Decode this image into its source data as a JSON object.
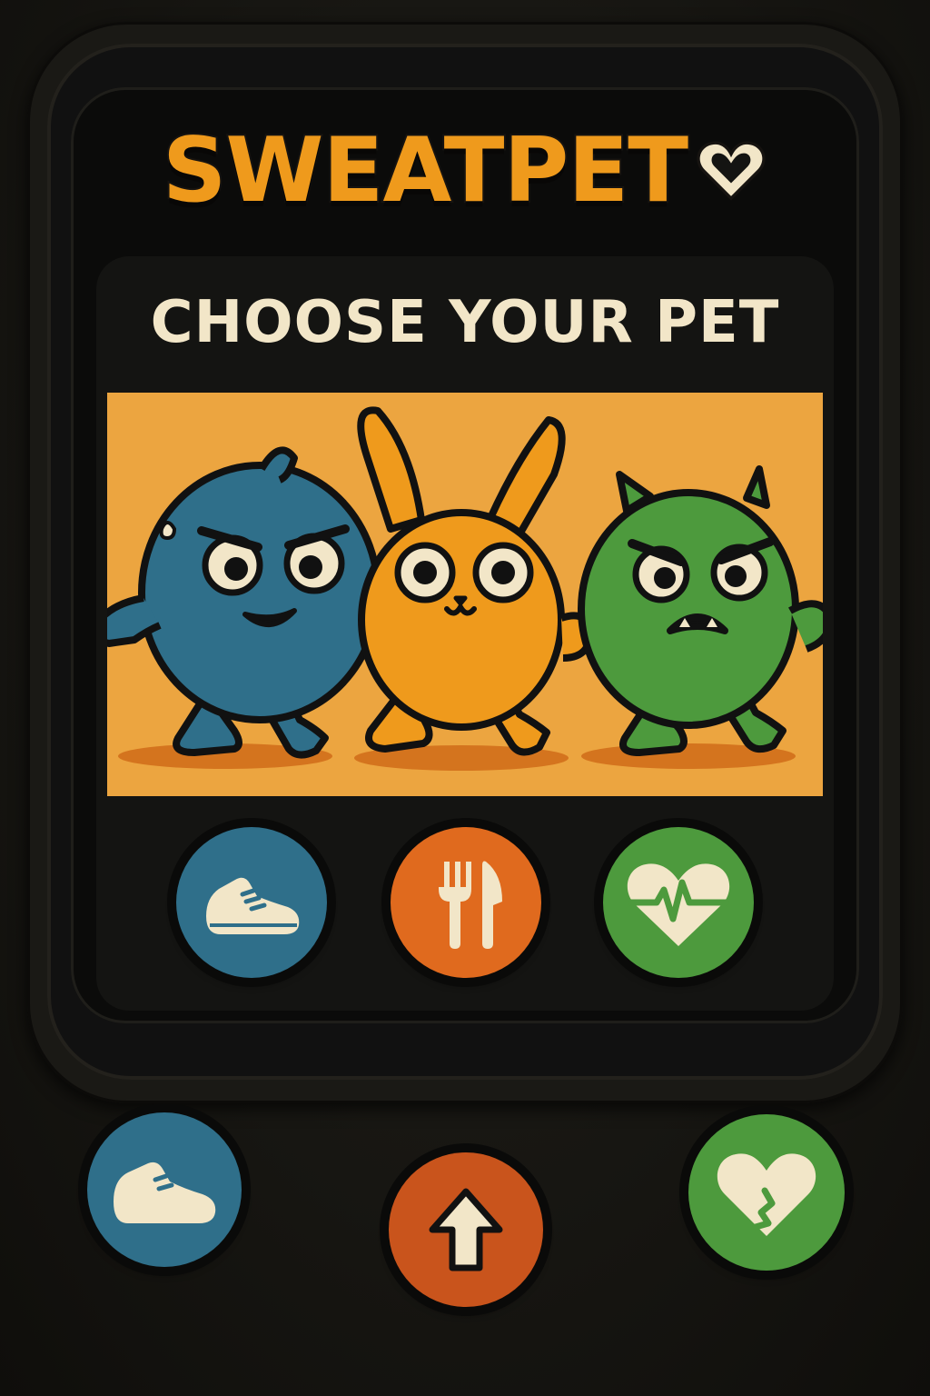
{
  "app": {
    "title": "SWEATPET",
    "title_icon": "heart-outline-icon",
    "brand_color": "#ef9a1c",
    "text_color": "#f2e6c8"
  },
  "screen": {
    "heading": "CHOOSE YOUR PET",
    "pets": [
      {
        "name_icon": "blue-blob-pet",
        "color": "#2f6f8a"
      },
      {
        "name_icon": "orange-bunny-pet",
        "color": "#ef9a1c"
      },
      {
        "name_icon": "green-monster-pet",
        "color": "#4d9a3d"
      }
    ],
    "actions": [
      {
        "icon": "sneaker-icon",
        "color": "#2f6f8a"
      },
      {
        "icon": "fork-knife-icon",
        "color": "#e06a1e"
      },
      {
        "icon": "heart-pulse-icon",
        "color": "#4d9a3d"
      }
    ]
  },
  "hardware_buttons": [
    {
      "icon": "sneaker-icon",
      "color": "#2f6f8a"
    },
    {
      "icon": "arrow-up-icon",
      "color": "#c9541c"
    },
    {
      "icon": "heart-crack-icon",
      "color": "#4d9a3d"
    }
  ]
}
